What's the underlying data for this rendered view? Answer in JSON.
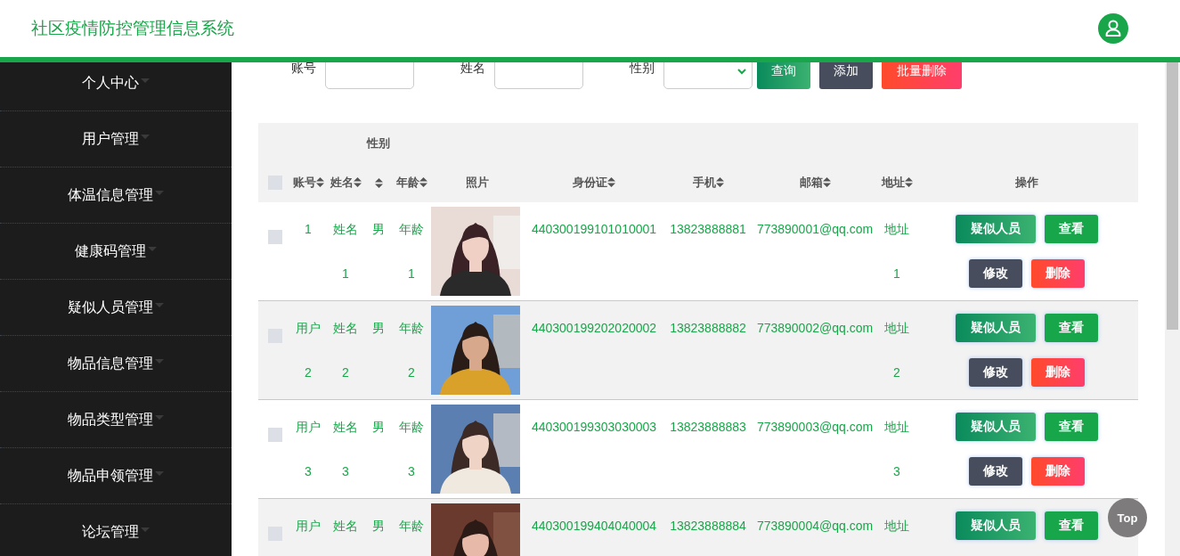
{
  "header": {
    "title": "社区疫情防控管理信息系统"
  },
  "sidebar": {
    "items": [
      {
        "label": "个人中心"
      },
      {
        "label": "用户管理"
      },
      {
        "label": "体温信息管理"
      },
      {
        "label": "健康码管理"
      },
      {
        "label": "疑似人员管理"
      },
      {
        "label": "物品信息管理"
      },
      {
        "label": "物品类型管理"
      },
      {
        "label": "物品申领管理"
      },
      {
        "label": "论坛管理"
      }
    ]
  },
  "search": {
    "fields": [
      {
        "label": "账号",
        "kind": "text"
      },
      {
        "label": "姓名",
        "kind": "text"
      },
      {
        "label": "性别",
        "kind": "select"
      }
    ],
    "buttons": [
      {
        "label": "查询",
        "kind": "search"
      },
      {
        "label": "添加",
        "kind": "add"
      },
      {
        "label": "批量删除",
        "kind": "delete"
      }
    ]
  },
  "table": {
    "select_all": {
      "checked": false
    },
    "columns": [
      {
        "label": "账号",
        "sortable": true
      },
      {
        "label": "姓名",
        "sortable": true
      },
      {
        "label": "性别",
        "sortable": true
      },
      {
        "label": "年龄",
        "sortable": true
      },
      {
        "label": "照片",
        "sortable": false
      },
      {
        "label": "身份证",
        "sortable": true
      },
      {
        "label": "手机",
        "sortable": true
      },
      {
        "label": "邮箱",
        "sortable": true
      },
      {
        "label": "地址",
        "sortable": true
      },
      {
        "label": "操作",
        "sortable": false
      }
    ],
    "rows": [
      {
        "checked": false,
        "account": "1",
        "name": "姓名1",
        "gender": "男",
        "age": "年龄1",
        "photo": {
          "kind": "picture"
        },
        "id_card": "440300199101010001",
        "phone": "13823888881",
        "email": "773890001@qq.com",
        "address": "地址1",
        "actions": [
          {
            "label": "疑似人员",
            "kind": "suspect"
          },
          {
            "label": "查看",
            "kind": "view"
          },
          {
            "label": "修改",
            "kind": "edit"
          },
          {
            "label": "删除",
            "kind": "delete"
          }
        ]
      },
      {
        "checked": false,
        "account": "用户2",
        "name": "姓名2",
        "gender": "男",
        "age": "年龄2",
        "photo": {
          "kind": "picture"
        },
        "id_card": "440300199202020002",
        "phone": "13823888882",
        "email": "773890002@qq.com",
        "address": "地址2",
        "actions": [
          {
            "label": "疑似人员",
            "kind": "suspect"
          },
          {
            "label": "查看",
            "kind": "view"
          },
          {
            "label": "修改",
            "kind": "edit"
          },
          {
            "label": "删除",
            "kind": "delete"
          }
        ]
      },
      {
        "checked": false,
        "account": "用户3",
        "name": "姓名3",
        "gender": "男",
        "age": "年龄3",
        "photo": {
          "kind": "picture"
        },
        "id_card": "440300199303030003",
        "phone": "13823888883",
        "email": "773890003@qq.com",
        "address": "地址3",
        "actions": [
          {
            "label": "疑似人员",
            "kind": "suspect"
          },
          {
            "label": "查看",
            "kind": "view"
          },
          {
            "label": "修改",
            "kind": "edit"
          },
          {
            "label": "删除",
            "kind": "delete"
          }
        ]
      },
      {
        "checked": false,
        "account": "用户",
        "name": "姓名",
        "gender": "男",
        "age": "年龄",
        "photo": {
          "kind": "picture"
        },
        "id_card": "440300199404040004",
        "phone": "13823888884",
        "email": "773890004@qq.com",
        "address": "地址",
        "actions": [
          {
            "label": "疑似人员",
            "kind": "suspect"
          },
          {
            "label": "查看",
            "kind": "view"
          }
        ]
      }
    ]
  },
  "top_button": {
    "label": "Top"
  }
}
